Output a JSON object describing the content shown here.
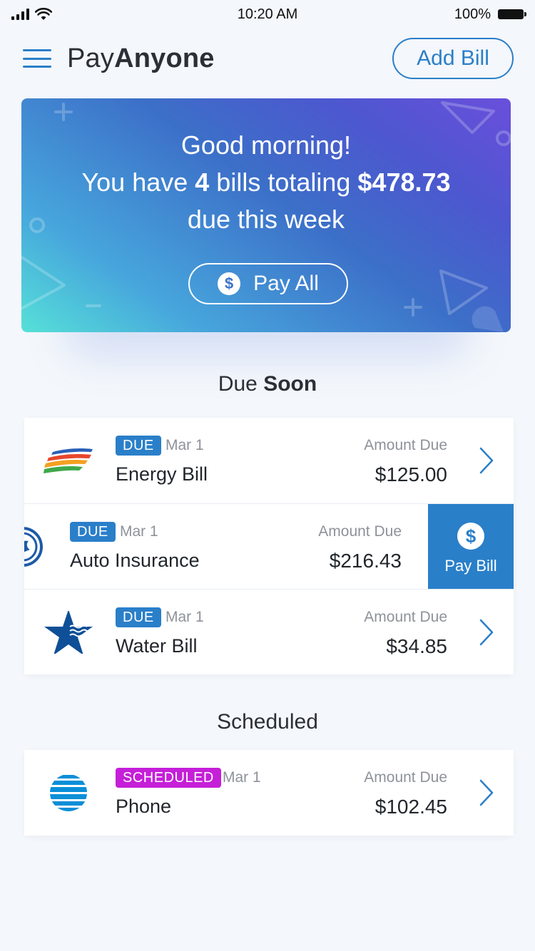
{
  "status_bar": {
    "time": "10:20 AM",
    "battery": "100%"
  },
  "header": {
    "title_light": "Pay",
    "title_bold": "Anyone",
    "add_bill_label": "Add Bill"
  },
  "hero": {
    "greeting": "Good morning!",
    "line2_prefix": "You have ",
    "bill_count": "4",
    "line2_middle": " bills totaling ",
    "total": "$478.73",
    "line3": "due this week",
    "pay_all_label": "Pay All",
    "dollar_symbol": "$"
  },
  "sections": {
    "due_soon_light": "Due ",
    "due_soon_bold": "Soon",
    "scheduled": "Scheduled"
  },
  "due_soon_bills": [
    {
      "badge": "DUE",
      "date": "Mar 1",
      "name": "Energy Bill",
      "amount_label": "Amount Due",
      "amount": "$125.00",
      "logo": "energy-logo-icon"
    },
    {
      "badge": "DUE",
      "date": "Mar 1",
      "name": "Auto Insurance",
      "amount_label": "Amount Due",
      "amount": "$216.43",
      "logo": "insurance-logo-icon",
      "swipe_action": "Pay Bill"
    },
    {
      "badge": "DUE",
      "date": "Mar 1",
      "name": "Water Bill",
      "amount_label": "Amount Due",
      "amount": "$34.85",
      "logo": "star-logo-icon"
    }
  ],
  "scheduled_bills": [
    {
      "badge": "SCHEDULED",
      "date": "Mar 1",
      "name": "Phone",
      "amount_label": "Amount Due",
      "amount": "$102.45",
      "logo": "globe-logo-icon"
    }
  ],
  "colors": {
    "accent": "#2a7fc9",
    "scheduled_badge": "#c51fd8",
    "background": "#f4f7fb",
    "text_muted": "#8e9299"
  }
}
